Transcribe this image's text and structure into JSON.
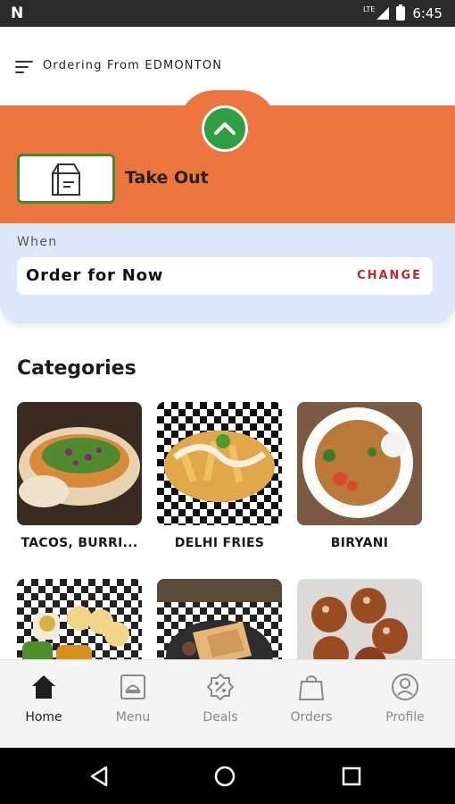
{
  "status_bar": {
    "carrier_logo": "N",
    "network": "LTE",
    "time": "6:45"
  },
  "header": {
    "menu_icon": "hamburger-menu-icon",
    "ordering_from": "Ordering From EDMONTON"
  },
  "order_type": {
    "selected": "Take Out",
    "icon": "takeout-bag-icon",
    "expand_icon": "chevron-up-icon",
    "accent_color": "#ec7540",
    "card_border_color": "#3f8a2a",
    "expand_color": "#2ea043"
  },
  "when": {
    "label": "When",
    "value": "Order for Now",
    "change_label": "CHANGE",
    "change_color": "#b8282c",
    "panel_color": "#dfe8fb"
  },
  "categories": {
    "title": "Categories",
    "items": [
      {
        "label": "TACOS, BURRI...",
        "image": "tacos-photo"
      },
      {
        "label": "DELHI FRIES",
        "image": "fries-photo"
      },
      {
        "label": "BIRYANI",
        "image": "biryani-photo"
      },
      {
        "label": "",
        "image": "pani-puri-photo"
      },
      {
        "label": "",
        "image": "wrap-photo"
      },
      {
        "label": "",
        "image": "dessert-balls-photo"
      }
    ]
  },
  "bottom_nav": {
    "items": [
      {
        "label": "Home",
        "icon": "home-icon",
        "active": true
      },
      {
        "label": "Menu",
        "icon": "menu-cloche-icon",
        "active": false
      },
      {
        "label": "Deals",
        "icon": "percent-badge-icon",
        "active": false
      },
      {
        "label": "Orders",
        "icon": "shopping-bag-icon",
        "active": false
      },
      {
        "label": "Profile",
        "icon": "profile-icon",
        "active": false
      }
    ]
  },
  "system_nav": {
    "back_icon": "back-triangle-icon",
    "home_icon": "home-circle-icon",
    "recents_icon": "recents-square-icon"
  }
}
